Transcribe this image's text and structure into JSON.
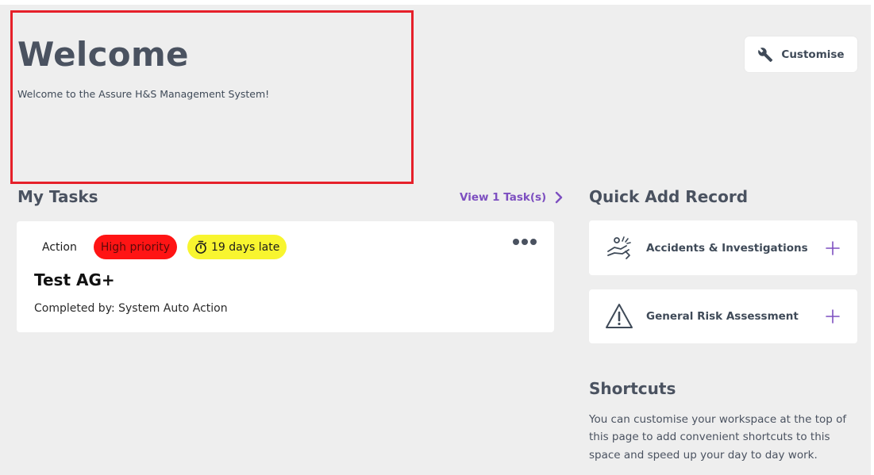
{
  "header": {
    "title": "Welcome",
    "subtitle": "Welcome to the Assure H&S Management System!",
    "customise_label": "Customise"
  },
  "tasks": {
    "title": "My Tasks",
    "view_link": "View 1 Task(s)",
    "items": [
      {
        "type": "Action",
        "priority": "High priority",
        "late": "19 days late",
        "title": "Test AG+",
        "completed_by": "Completed by: System Auto Action"
      }
    ]
  },
  "quick_add": {
    "title": "Quick Add Record",
    "items": [
      {
        "label": "Accidents & Investigations",
        "icon": "accident-icon"
      },
      {
        "label": "General Risk Assessment",
        "icon": "warning-triangle-icon"
      }
    ]
  },
  "shortcuts": {
    "title": "Shortcuts",
    "text": "You can customise your workspace at the top of this page to add convenient shortcuts to this space and speed up your day to day work."
  },
  "colors": {
    "accent": "#7d4fc0",
    "high_priority": "#ff1414",
    "late": "#f8f52f",
    "highlight_border": "#e6202a",
    "background": "#eeeeee"
  }
}
